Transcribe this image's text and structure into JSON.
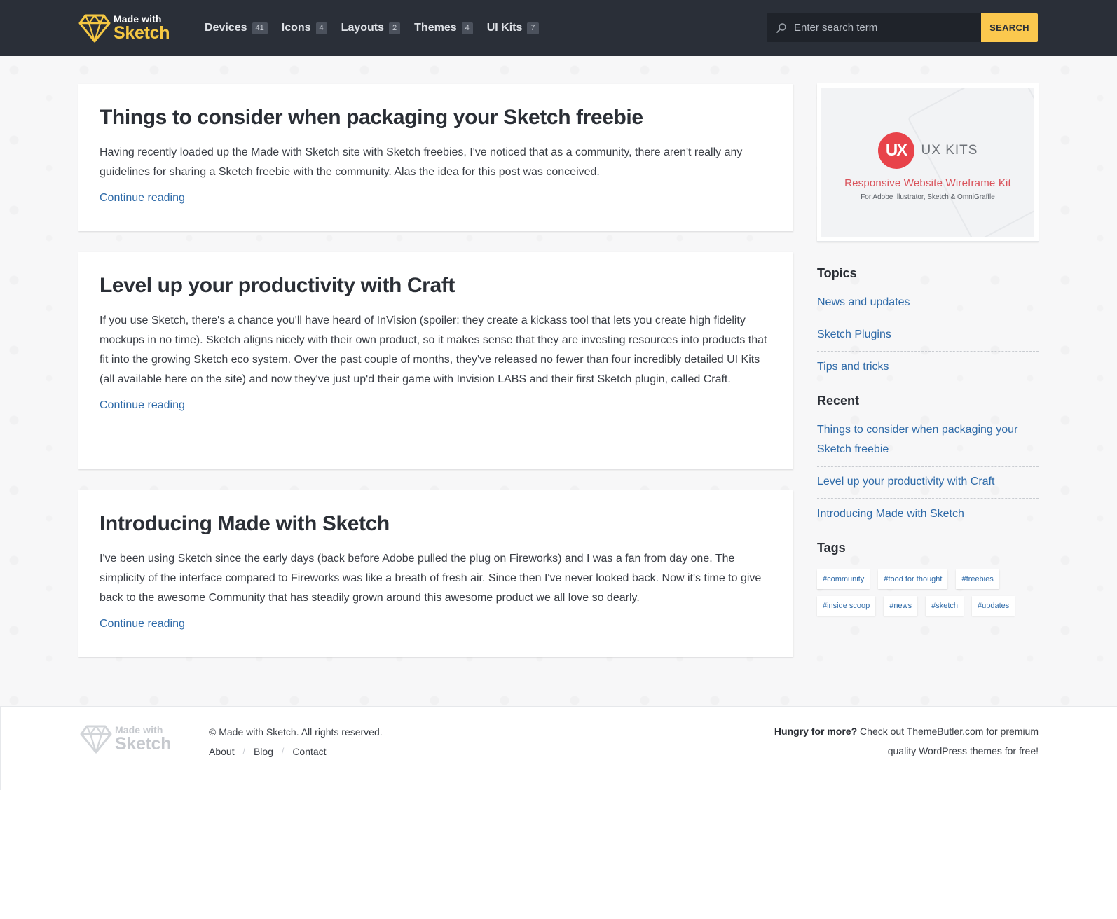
{
  "header": {
    "logo": {
      "small": "Made with",
      "big": "Sketch"
    },
    "nav": [
      {
        "label": "Devices",
        "count": "41"
      },
      {
        "label": "Icons",
        "count": "4"
      },
      {
        "label": "Layouts",
        "count": "2"
      },
      {
        "label": "Themes",
        "count": "4"
      },
      {
        "label": "UI Kits",
        "count": "7"
      }
    ],
    "search": {
      "placeholder": "Enter search term",
      "value": "",
      "button": "SEARCH"
    }
  },
  "posts": [
    {
      "title": "Things to consider when packaging your Sketch freebie",
      "excerpt": "Having recently loaded up the Made with Sketch site with Sketch freebies, I've noticed that as a community, there aren't really any guidelines for sharing a Sketch freebie with the community. Alas the idea for this post was conceived.",
      "link": "Continue reading"
    },
    {
      "title": "Level up your productivity with Craft",
      "excerpt": "If you use Sketch, there's a chance you'll have heard of InVision (spoiler: they create a kickass tool that lets you create high fidelity mockups in no time). Sketch aligns nicely with their own product, so it makes sense that they are investing resources into products that fit into the growing Sketch eco system. Over the past couple of months, they've released no fewer than four incredibly detailed UI Kits (all available here on the site) and now they've just up'd their game with Invision LABS and their first Sketch plugin, called Craft.",
      "link": "Continue reading"
    },
    {
      "title": "Introducing Made with Sketch",
      "excerpt": "I've been using Sketch since the early days (back before Adobe pulled the plug on Fireworks) and I was a fan from day one. The simplicity of the interface compared to Fireworks was like a breath of fresh air. Since then I've never looked back. Now it's time to give back to the awesome Community that has steadily grown around this awesome product we all love so dearly.",
      "link": "Continue reading"
    }
  ],
  "sidebar": {
    "ad": {
      "logo_letters": "UX",
      "brand": "UX KITS",
      "headline": "Responsive Website Wireframe Kit",
      "sub": "For Adobe Illustrator, Sketch & OmniGraffle"
    },
    "topics": {
      "heading": "Topics",
      "items": [
        "News and updates",
        "Sketch Plugins",
        "Tips and tricks"
      ]
    },
    "recent": {
      "heading": "Recent",
      "items": [
        "Things to consider when packaging your Sketch freebie",
        "Level up your productivity with Craft",
        "Introducing Made with Sketch"
      ]
    },
    "tags": {
      "heading": "Tags",
      "items": [
        "#community",
        "#food for thought",
        "#freebies",
        "#inside scoop",
        "#news",
        "#sketch",
        "#updates"
      ]
    }
  },
  "footer": {
    "logo": {
      "small": "Made with",
      "big": "Sketch"
    },
    "copyright": "© Made with Sketch. All rights reserved.",
    "links": [
      "About",
      "Blog",
      "Contact"
    ],
    "promo_bold": "Hungry for more?",
    "promo_text": " Check out ThemeButler.com for premium quality WordPress themes for free!"
  },
  "colors": {
    "header_bg": "#2a2f38",
    "accent_yellow": "#fbc84e",
    "link_blue": "#2e6aa8",
    "ad_red": "#e8434a"
  }
}
